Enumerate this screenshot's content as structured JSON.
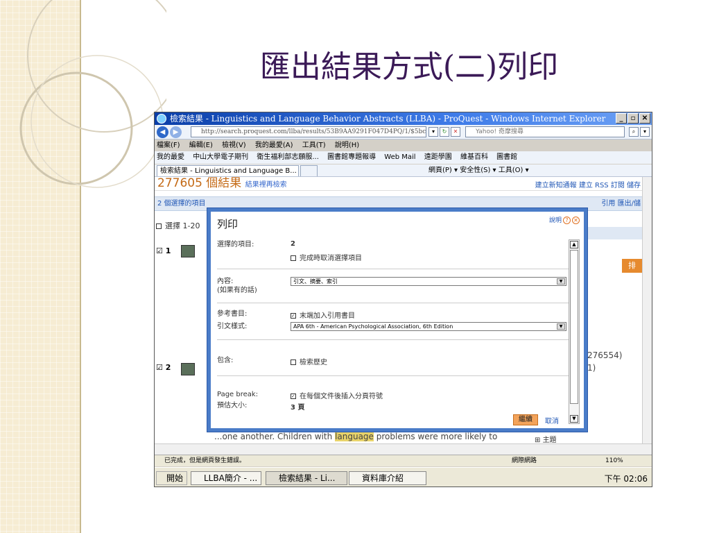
{
  "slide": {
    "title": "匯出結果方式(二)列印"
  },
  "window": {
    "title": "檢索結果 - Linguistics and Language Behavior Abstracts (LLBA) - ProQuest - Windows Internet Explorer",
    "url": "http://search.proquest.com/llba/results/53B9AA9291F047D4PQ/1/$5bc",
    "search_placeholder": "Yahoo! 奇摩搜尋",
    "menu": [
      "檔案(F)",
      "編輯(E)",
      "檢視(V)",
      "我的最愛(A)",
      "工具(T)",
      "說明(H)"
    ],
    "favorites": [
      "我的最愛",
      "中山大學電子期刊",
      "衛生福利部志願服...",
      "圖書館專題報導",
      "Web Mail",
      "遠距學園",
      "維基百科",
      "圖書館"
    ],
    "tab_label": "檢索結果 - Linguistics and Language B...",
    "command_bar": "網頁(P) ▾  安全性(S) ▾  工具(O) ▾",
    "status_text": "已完成，但是網頁發生錯誤。",
    "status_zone": "網際網路",
    "zoom": "110%"
  },
  "page": {
    "result_count": "277605 個結果",
    "refine": "結果裡再檢索",
    "header_links": "建立新知通報  建立 RSS 訂閱  儲存",
    "selected_bar": "2 個選擇的項目",
    "bar_actions": "引用  匯出/儲",
    "select_range": "選擇 1-20",
    "row1": "1",
    "row2": "2",
    "side_nums": [
      "276554)",
      "1)"
    ],
    "sort_btn": "排",
    "snippet_pre": "...one another. Children with ",
    "snippet_hl": "language",
    "snippet_post": " problems were more likely to",
    "subject": "主題"
  },
  "dialog": {
    "title": "列印",
    "help": "說明",
    "selected_label": "選擇的項目:",
    "selected_count": "2",
    "deselect_label": "完成時取消選擇項目",
    "content_label": "內容:",
    "content_sub": "(如果有的話)",
    "content_value": "引文、摘要、索引",
    "biblio_label": "參考書目:",
    "biblio_value": "末端加入引用書目",
    "style_label": "引文樣式:",
    "style_value": "APA 6th - American Psychological Association, 6th Edition",
    "include_label": "包含:",
    "include_value": "檢索歷史",
    "pagebreak_label": "Page break:",
    "pagebreak_value": "在每個文件後插入分頁符號",
    "size_label": "預估大小:",
    "size_value": "3 頁",
    "continue_label": "繼續",
    "cancel_label": "取消"
  },
  "taskbar": {
    "start": "開始",
    "items": [
      "LLBA簡介 - ...",
      "檢索結果 - Li...",
      "資料庫介紹"
    ],
    "clock": "下午 02:06"
  }
}
